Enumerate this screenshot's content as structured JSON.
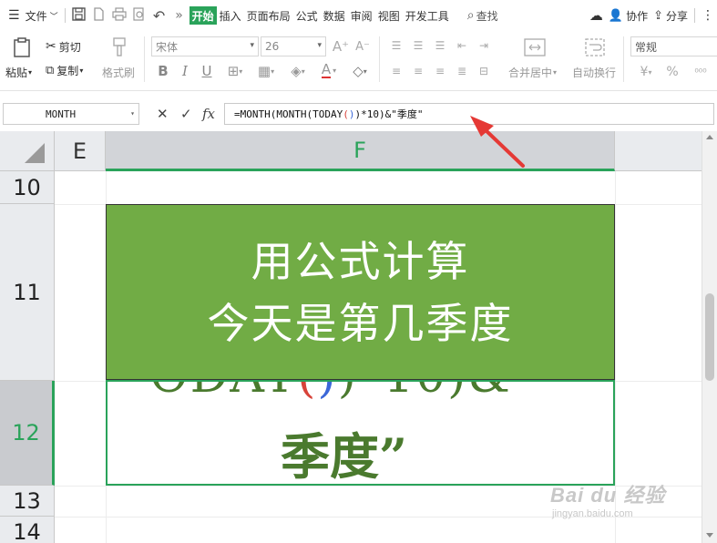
{
  "menubar": {
    "file_label": "文件",
    "tabs": [
      "开始",
      "插入",
      "页面布局",
      "公式",
      "数据",
      "审阅",
      "视图",
      "开发工具"
    ],
    "more_label": "»",
    "search_label": "查找",
    "collab_label": "协作",
    "share_label": "分享"
  },
  "ribbon": {
    "paste_label": "粘贴",
    "cut_label": "剪切",
    "copy_label": "复制",
    "format_painter_label": "格式刷",
    "font_name": "宋体",
    "font_size": "26",
    "bold_glyph": "B",
    "italic_glyph": "I",
    "underline_glyph": "U",
    "font_color_glyph": "A",
    "merge_label": "合并居中",
    "wrap_label": "自动换行",
    "number_format": "常规",
    "currency_glyph": "¥",
    "percent_glyph": "%"
  },
  "formula_bar": {
    "name_box": "MONTH",
    "fx_label": "fx",
    "formula_a": "=MONTH(MONTH(TODAY",
    "formula_p1": "(",
    "formula_p2": ")",
    "formula_b": ")*10)&\"季度\""
  },
  "grid": {
    "columns": [
      "E",
      "F"
    ],
    "rows": [
      "10",
      "11",
      "12",
      "13",
      "14"
    ],
    "selected_column": "F",
    "selected_row": "12"
  },
  "overlay": {
    "line1": "用公式计算",
    "line2": "今天是第几季度",
    "peek_a": "ODAY",
    "peek_p1": "(",
    "peek_p2": ")",
    "peek_b": ")*10)&",
    "cell_text": "季度”"
  },
  "watermark": {
    "line1": "Bai du 经验",
    "line2": "jingyan.baidu.com"
  },
  "colors": {
    "accent_green": "#2aa35a",
    "banner_green": "#71ac45",
    "arrow_red": "#e53935"
  }
}
